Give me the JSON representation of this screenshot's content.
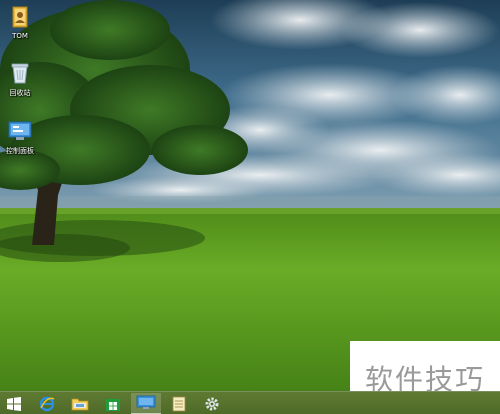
{
  "desktop": {
    "icons": [
      {
        "label": "TOM",
        "icon": "user-folder-icon"
      },
      {
        "label": "回收站",
        "icon": "recycle-bin-icon"
      },
      {
        "label": "控制面板",
        "icon": "control-panel-icon"
      }
    ]
  },
  "taskbar": {
    "items": [
      {
        "icon": "windows-start-icon"
      },
      {
        "icon": "internet-explorer-icon"
      },
      {
        "icon": "file-explorer-icon"
      },
      {
        "icon": "windows-store-icon"
      },
      {
        "icon": "control-panel-icon",
        "active": true
      },
      {
        "icon": "notepad-icon"
      },
      {
        "icon": "settings-gear-icon"
      }
    ]
  },
  "watermark": {
    "text": "软件技巧"
  },
  "colors": {
    "taskbar": "#56722d",
    "sky": "#3d6a8a",
    "grass": "#5e9a22"
  }
}
